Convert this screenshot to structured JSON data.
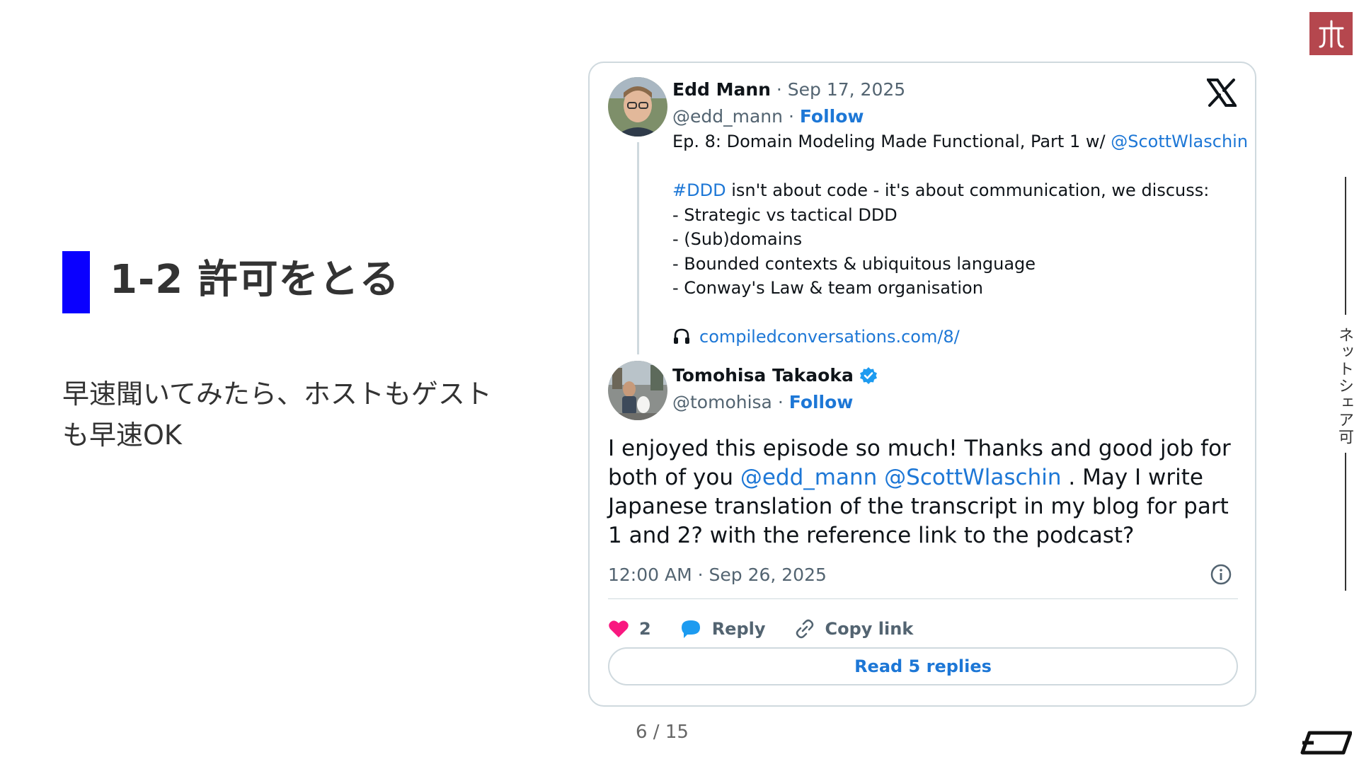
{
  "slide": {
    "title": "1-2 許可をとる",
    "body": "早速聞いてみたら、ホストもゲストも早速OK",
    "vertical_label": "ネットシェア可",
    "page_counter": "6 / 15",
    "accent_color": "#0a00ff",
    "logo_color": "#b5474e"
  },
  "tweet1": {
    "name": "Edd Mann",
    "date": "· Sep 17, 2025",
    "handle": "@edd_mann",
    "separator": "·",
    "follow": "Follow",
    "line1_text": "Ep. 8: Domain Modeling Made Functional, Part 1 w/ ",
    "line1_mention": "@ScottWlaschin",
    "hashtag": "#DDD",
    "line2_text": " isn't about code - it's about communication, we discuss:",
    "bullets": [
      "- Strategic vs tactical DDD",
      "- (Sub)domains",
      "- Bounded contexts & ubiquitous language",
      "- Conway's Law & team organisation"
    ],
    "link": "compiledconversations.com/8/"
  },
  "tweet2": {
    "name": "Tomohisa Takaoka",
    "handle": "@tomohisa",
    "separator": "·",
    "follow": "Follow",
    "body_part1": "I enjoyed this episode so much! Thanks and good job for both of you ",
    "mention1": "@edd_mann",
    "mention2": "@ScottWlaschin",
    "body_part2": " . May I write Japanese translation of the transcript in my blog for part 1 and 2? with the reference link to the podcast?",
    "timestamp": "12:00 AM · Sep 26, 2025",
    "likes": "2",
    "reply_label": "Reply",
    "copy_label": "Copy link",
    "read_replies": "Read 5 replies"
  }
}
